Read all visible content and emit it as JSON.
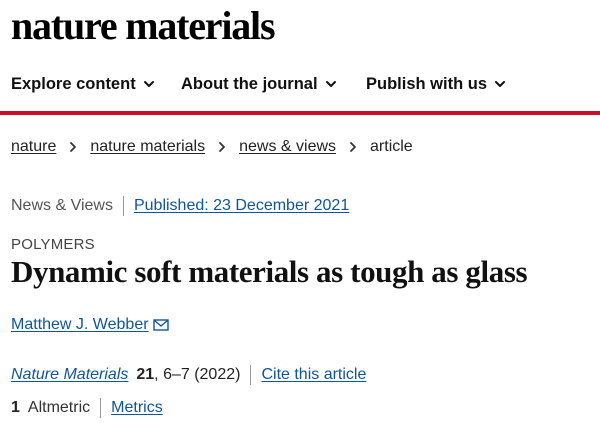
{
  "header": {
    "brand": "nature materials"
  },
  "nav": {
    "items": [
      {
        "label": "Explore content"
      },
      {
        "label": "About the journal"
      },
      {
        "label": "Publish with us"
      }
    ]
  },
  "breadcrumb": {
    "items": [
      "nature",
      "nature materials",
      "news & views"
    ],
    "current": "article"
  },
  "article": {
    "type": "News & Views",
    "published": "Published: 23 December 2021",
    "subject": "POLYMERS",
    "title": "Dynamic soft materials as tough as glass",
    "author": "Matthew J. Webber",
    "journal": "Nature Materials",
    "volume": "21",
    "pages_year": ", 6–7 (2022)",
    "cite_label": "Cite this article",
    "altmetric_count": "1",
    "altmetric_label": "Altmetric",
    "metrics_label": "Metrics"
  },
  "colors": {
    "accent_red": "#c8102e",
    "link_blue": "#0f5599"
  },
  "icons": {
    "nav_chevron": "chevron-down-icon",
    "breadcrumb_separator": "chevron-right-icon",
    "author_contact": "mail-icon"
  }
}
